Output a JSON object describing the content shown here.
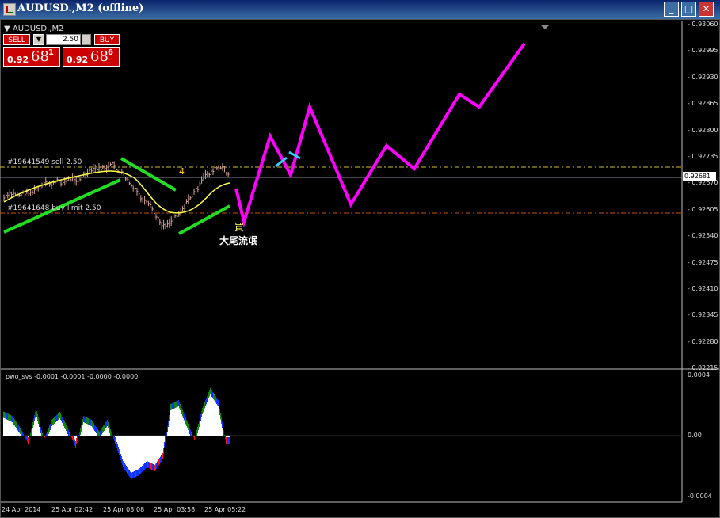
{
  "window": {
    "title": "AUDUSD.,M2 (offline)",
    "chart_label": "AUDUSD.,M2"
  },
  "trade_panel": {
    "sell_label": "SELL",
    "buy_label": "BUY",
    "lot_value": "2.50",
    "sell_price_main": "0.92",
    "sell_price_big": "68",
    "sell_price_sup": "1",
    "buy_price_main": "0.92",
    "buy_price_big": "68",
    "buy_price_sup": "6"
  },
  "orders": {
    "sell_order": "#19641549 sell 2.50",
    "buy_limit_order": "#19641648 buy limit 2.50"
  },
  "annotations": {
    "wave_number": "4",
    "buy_char": "買",
    "caption": "大尾流氓"
  },
  "price_axis": [
    "0.93060",
    "0.92995",
    "0.92930",
    "0.92865",
    "0.92800",
    "0.92735",
    "0.92670",
    "0.92605",
    "0.92540",
    "0.92475",
    "0.92410",
    "0.92345",
    "0.92280",
    "0.92215"
  ],
  "current_price": "0.92681",
  "indicator": {
    "label": "pwo_svs -0.0001 -0.0001 -0.0000 -0.0000",
    "axis": [
      "0.0004",
      "0.00",
      "-0.0004"
    ]
  },
  "time_axis": [
    "24 Apr 2014",
    "25 Apr 02:42",
    "25 Apr 03:08",
    "25 Apr 03:58",
    "25 Apr 05:22"
  ],
  "colors": {
    "projection": "#ff00ff",
    "channel": "#22dd22",
    "ma": "#ffff44",
    "cyan_mark": "#33ccff",
    "sell_line": "#ccbb33",
    "buy_limit_line": "#cc5500"
  }
}
